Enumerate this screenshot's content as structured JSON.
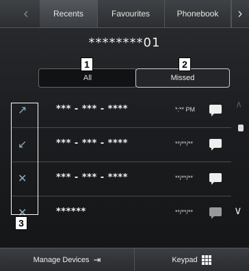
{
  "tabs": [
    "Recents",
    "Favourites",
    "Phonebook"
  ],
  "nav": {
    "left_icon": "chevron-left-icon",
    "right_icon": "chevron-right-icon"
  },
  "title": "********01",
  "filters": {
    "all": "All",
    "missed": "Missed"
  },
  "callouts": {
    "one": "1",
    "two": "2",
    "three": "3"
  },
  "calls": [
    {
      "number": "*** - *** - ****",
      "time": "*:** PM",
      "icon": "outgoing-call-icon",
      "message_dim": false
    },
    {
      "number": "*** - *** - ****",
      "time": "**/**/**",
      "icon": "incoming-call-icon",
      "message_dim": false
    },
    {
      "number": "*** - *** - ****",
      "time": "**/**/**",
      "icon": "missed-call-icon",
      "message_dim": false
    },
    {
      "number": "******",
      "time": "**/**/**",
      "icon": "missed-call-icon",
      "message_dim": true
    }
  ],
  "bottom": {
    "manage": "Manage Devices",
    "keypad": "Keypad"
  }
}
